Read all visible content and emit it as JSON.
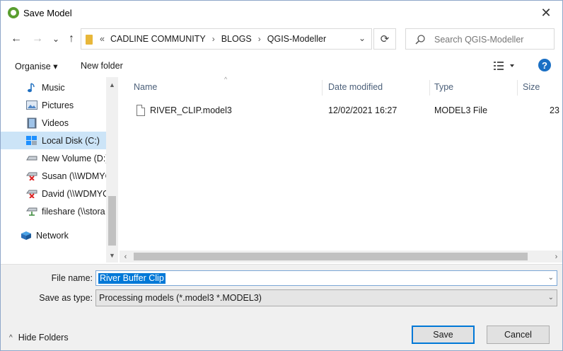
{
  "window": {
    "title": "Save Model",
    "close_glyph": "✕"
  },
  "nav": {
    "back_glyph": "←",
    "forward_glyph": "→",
    "recent_glyph": "⌄",
    "up_glyph": "↑",
    "breadcrumb_prefix": "«",
    "breadcrumb": [
      "CADLINE COMMUNITY",
      "BLOGS",
      "QGIS-Modeller"
    ],
    "breadcrumb_sep": "›",
    "dropdown_glyph": "⌄",
    "refresh_glyph": "⟳",
    "search_placeholder": "Search QGIS-Modeller"
  },
  "commands": {
    "organise": "Organise ▾",
    "new_folder": "New folder",
    "help": "?"
  },
  "sidebar": {
    "items": [
      {
        "label": "Music",
        "icon": "music-icon"
      },
      {
        "label": "Pictures",
        "icon": "pictures-icon"
      },
      {
        "label": "Videos",
        "icon": "videos-icon"
      },
      {
        "label": "Local Disk (C:)",
        "icon": "local-disk-icon",
        "selected": true
      },
      {
        "label": "New Volume (D:)",
        "icon": "drive-icon"
      },
      {
        "label": "Susan (\\\\WDMYC",
        "icon": "disconnected-drive-icon"
      },
      {
        "label": "David (\\\\WDMYC",
        "icon": "disconnected-drive-icon"
      },
      {
        "label": "fileshare (\\\\stora",
        "icon": "network-drive-icon"
      },
      {
        "label": "Network",
        "icon": "network-icon"
      }
    ],
    "scroll_up": "▲",
    "scroll_down": "▼"
  },
  "filelist": {
    "columns": [
      "Name",
      "Date modified",
      "Type",
      "Size"
    ],
    "sort_caret": "^",
    "rows": [
      {
        "name": "RIVER_CLIP.model3",
        "date": "12/02/2021 16:27",
        "type": "MODEL3 File",
        "size": "23"
      }
    ],
    "hscroll_left": "‹",
    "hscroll_right": "›"
  },
  "form": {
    "file_name_label": "File name:",
    "file_name_value": "River Buffer Clip",
    "save_as_label": "Save as type:",
    "save_as_value": "Processing models (*.model3 *.MODEL3)",
    "combo_caret": "⌄"
  },
  "footer": {
    "hide_folders": "Hide Folders",
    "hide_chevron": "^",
    "save": "Save",
    "cancel": "Cancel"
  },
  "colors": {
    "accent": "#0078d7",
    "selected_row": "#cce4f7",
    "folder": "#e8b73a",
    "help": "#1a6fc4"
  }
}
